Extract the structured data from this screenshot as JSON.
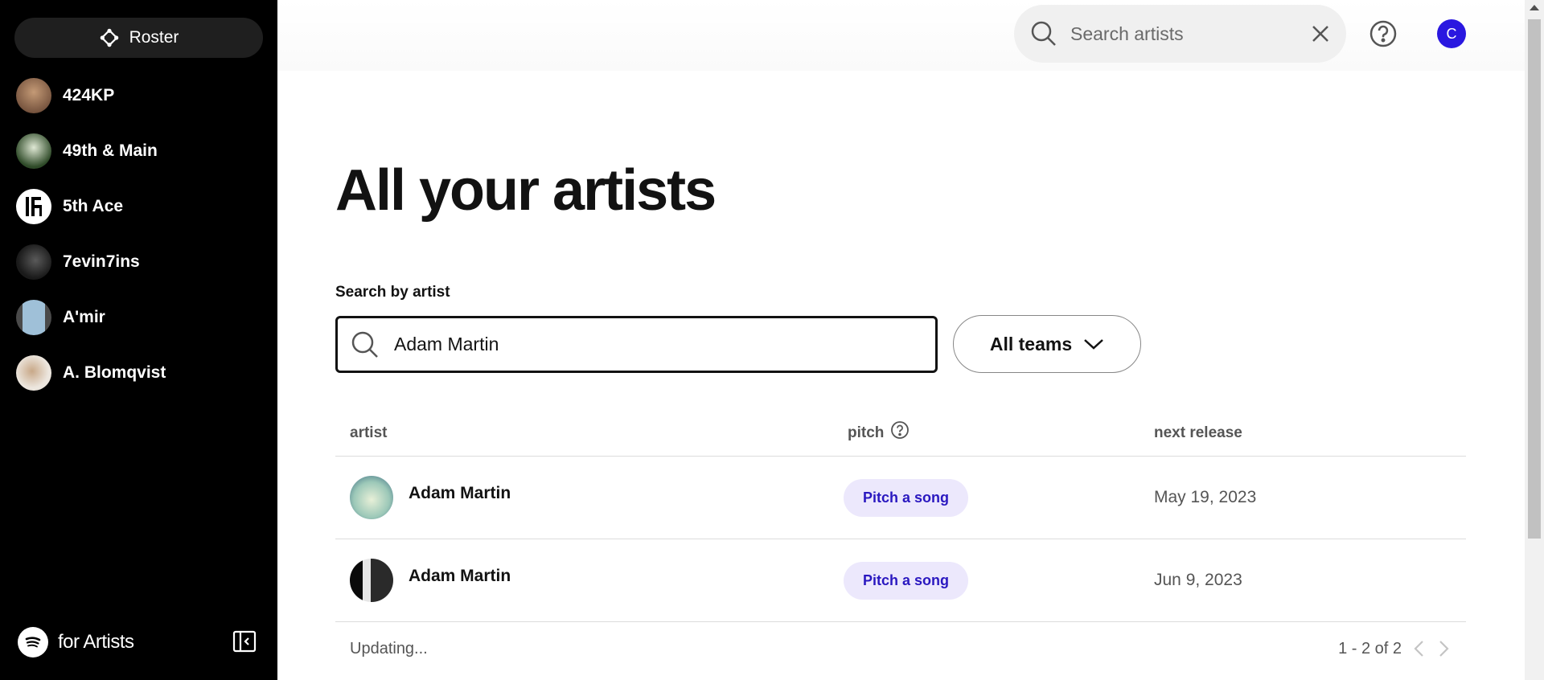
{
  "sidebar": {
    "roster_label": "Roster",
    "artists": [
      {
        "name": "424KP",
        "avatar_color": "#7a5a44"
      },
      {
        "name": "49th & Main",
        "avatar_color": "#3a5a30"
      },
      {
        "name": "5th Ace",
        "avatar_color": "#ffffff"
      },
      {
        "name": "7evin7ins",
        "avatar_color": "#2a2a2a"
      },
      {
        "name": "A'mir",
        "avatar_color": "#8fa4b8"
      },
      {
        "name": "A. Blomqvist",
        "avatar_color": "#d8cfc4"
      }
    ],
    "brand_text": "for Artists"
  },
  "topbar": {
    "search_placeholder": "Search artists",
    "user_initial": "C",
    "accent_color": "#2a18e0"
  },
  "main": {
    "title": "All your artists",
    "search_label": "Search by artist",
    "search_value": "Adam Martin",
    "teams_label": "All teams"
  },
  "table": {
    "headers": {
      "artist": "artist",
      "pitch": "pitch",
      "next_release": "next release"
    },
    "rows": [
      {
        "name": "Adam Martin",
        "pitch_label": "Pitch a song",
        "next_release": "May 19, 2023",
        "avatar_color": "#b9d8c8"
      },
      {
        "name": "Adam Martin",
        "pitch_label": "Pitch a song",
        "next_release": "Jun 9, 2023",
        "avatar_color": "#1a1a1a"
      }
    ],
    "status": "Updating...",
    "pagination": "1 - 2 of 2"
  }
}
